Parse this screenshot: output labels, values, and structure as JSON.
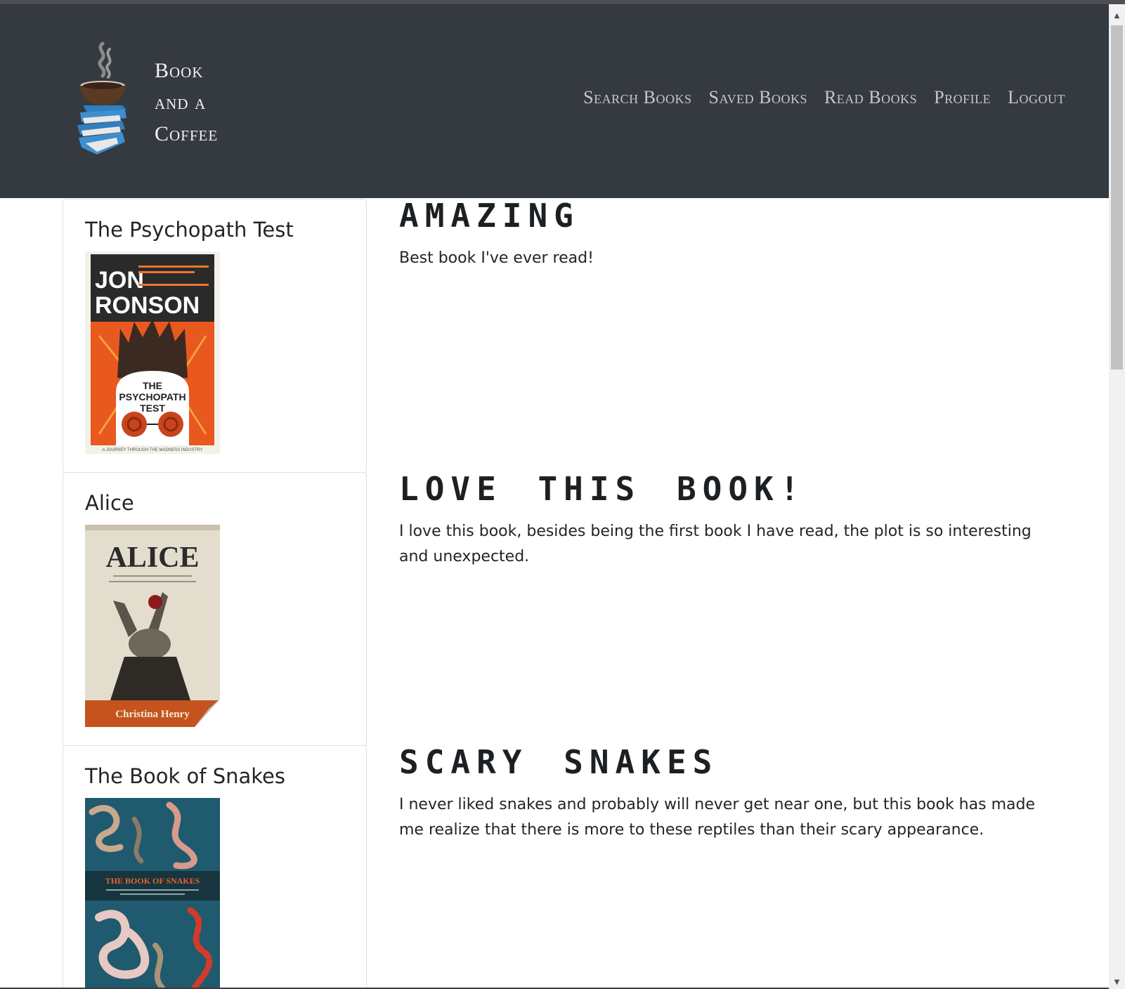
{
  "brand": {
    "line1": "Book",
    "line2": "and a",
    "line3": "Coffee"
  },
  "nav": {
    "items": [
      "Search Books",
      "Saved Books",
      "Read Books",
      "Profile",
      "Logout"
    ]
  },
  "reviews": [
    {
      "book_title": "The Psychopath Test",
      "review_title": "AMAZING",
      "review_text": "Best book I've ever read!",
      "cover": {
        "author_line1": "JON",
        "author_line2": "RONSON",
        "title_line1": "THE",
        "title_line2": "PSYCHOPATH",
        "title_line3": "TEST",
        "tagline": "A JOURNEY THROUGH THE MADNESS INDUSTRY"
      }
    },
    {
      "book_title": "Alice",
      "review_title": "LOVE THIS BOOK!",
      "review_text": "I love this book, besides being the first book I have read, the plot is so interesting and unexpected.",
      "cover": {
        "title": "ALICE",
        "author": "Christina Henry"
      }
    },
    {
      "book_title": "The Book of Snakes",
      "review_title": "SCARY SNAKES",
      "review_text": "I never liked snakes and probably will never get near one, but this book has made me realize that there is more to these reptiles than their scary appearance.",
      "cover": {
        "title": "THE BOOK OF SNAKES"
      }
    }
  ],
  "colors": {
    "navbar_bg": "#343a40",
    "nav_link": "#c5c8cc",
    "brand_text": "#f1f1f1",
    "card_border": "#dee2e6"
  }
}
